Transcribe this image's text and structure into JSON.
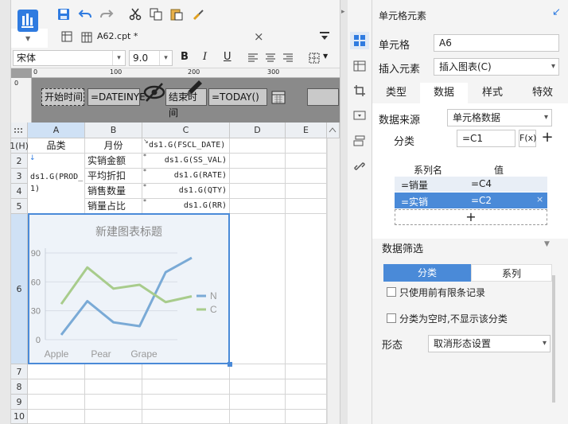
{
  "toolbar": {
    "icons": [
      "app-logo",
      "save-icon",
      "undo-icon",
      "redo-icon",
      "cut-icon",
      "copy-icon",
      "paste-icon",
      "format-brush-icon"
    ]
  },
  "tab": {
    "filename": "A62.cpt *",
    "close": "×"
  },
  "format": {
    "font": "宋体",
    "size": "9.0",
    "bold": "B",
    "italic": "I",
    "underline": "U"
  },
  "params": {
    "start_label": "开始时间",
    "start_value": "=DATEINYE",
    "end_label": "结束时间",
    "end_value": "=TODAY()",
    "ruler_marks": [
      "0",
      "100",
      "200",
      "300"
    ]
  },
  "grid": {
    "columns": [
      "A",
      "B",
      "C",
      "D",
      "E"
    ],
    "rows": [
      "1(H)",
      "2",
      "3",
      "4",
      "5",
      "6",
      "7",
      "8",
      "9",
      "10"
    ],
    "cells": {
      "A1": "品类",
      "B1": "月份",
      "C1": "ds1.G(FSCL_DATE)",
      "A2": "ds1.G(PROD_",
      "A2b": "1)",
      "B2": "实销金额",
      "C2": "ds1.G(SS_VAL)",
      "B3": "平均折扣",
      "C3": "ds1.G(RATE)",
      "B4": "销售数量",
      "C4": "ds1.G(QTY)",
      "B5": "销量占比",
      "C5": "ds1.G(RR)"
    }
  },
  "chart_data": {
    "type": "line",
    "title": "新建图表标题",
    "categories": [
      "Apple",
      "Pear",
      "Grape"
    ],
    "x_points": [
      0,
      1,
      2,
      3,
      4,
      5,
      6
    ],
    "series": [
      {
        "name": "N",
        "color": "#7aaad6",
        "values": [
          5,
          40,
          18,
          14,
          70,
          85
        ]
      },
      {
        "name": "C",
        "color": "#a8cc8c",
        "values": [
          37,
          75,
          53,
          57,
          39,
          45
        ]
      }
    ],
    "y_ticks": [
      "0",
      "30",
      "60",
      "90"
    ],
    "ylim": [
      0,
      90
    ],
    "legend": "right"
  },
  "panel": {
    "title": "单元格元素",
    "cell_label": "单元格",
    "cell_value": "A6",
    "insert_label": "插入元素",
    "insert_value": "插入图表(C)",
    "tabs": [
      "类型",
      "数据",
      "样式",
      "特效"
    ],
    "source_label": "数据来源",
    "source_value": "单元格数据",
    "category_label": "分类",
    "category_value": "=C1",
    "fx": "F(x)",
    "plus": "+",
    "series_header_name": "系列名",
    "series_header_value": "值",
    "series_rows": [
      {
        "name": "=销量",
        "value": "=C4"
      },
      {
        "name": "=实销",
        "value": "=C2"
      }
    ],
    "add": "+",
    "filter_label": "数据筛选",
    "filter_tabs": [
      "分类",
      "系列"
    ],
    "opt1": "只使用前有限条记录",
    "opt2": "分类为空时,不显示该分类",
    "shape_label": "形态",
    "shape_value": "取消形态设置"
  }
}
